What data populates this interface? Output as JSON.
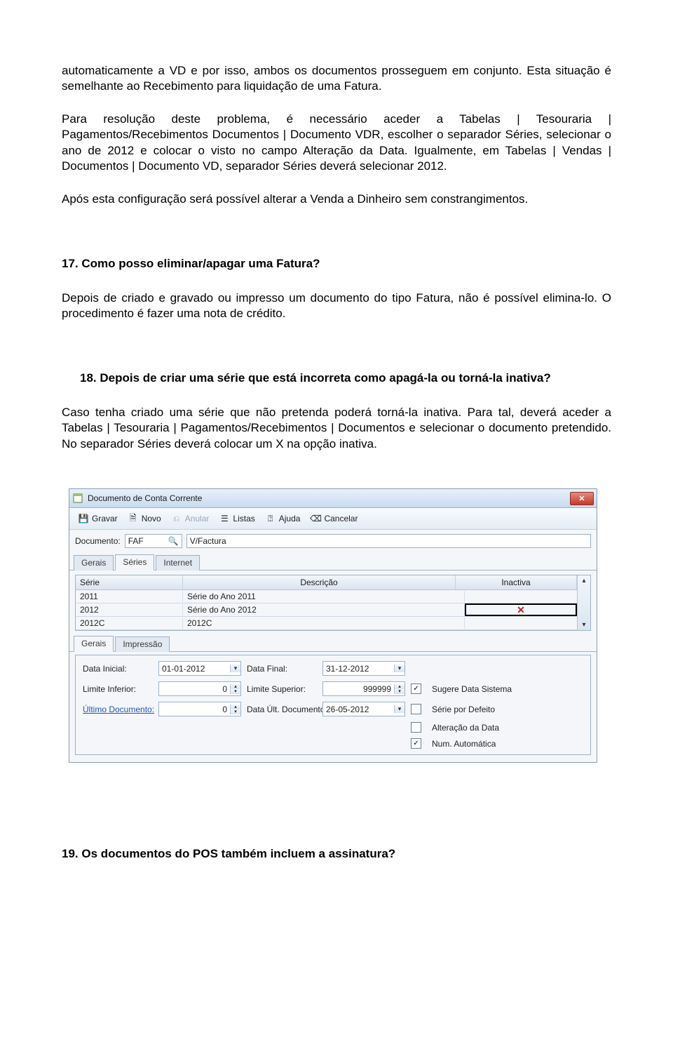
{
  "para1": "automaticamente a VD e por isso, ambos os documentos prosseguem em conjunto. Esta situação é semelhante ao Recebimento para liquidação de uma Fatura.",
  "para2": "Para resolução deste problema, é necessário aceder a Tabelas | Tesouraria | Pagamentos/Recebimentos Documentos | Documento VDR, escolher o separador Séries, selecionar o ano de 2012 e colocar o visto no campo Alteração da Data. Igualmente, em Tabelas | Vendas | Documentos | Documento VD, separador Séries deverá selecionar 2012.",
  "para3": "Após esta configuração será possível alterar a Venda a Dinheiro sem constrangimentos.",
  "q17_num": "17.",
  "q17_text": "Como posso eliminar/apagar uma Fatura?",
  "a17": "Depois de criado e gravado ou impresso um documento do tipo Fatura, não é possível elimina-lo. O procedimento é fazer uma nota de crédito.",
  "q18_num": "18.",
  "q18_text": "Depois de criar uma série que está incorreta como apagá-la ou torná-la inativa?",
  "a18": "Caso tenha criado uma série que não pretenda poderá torná-la inativa. Para tal, deverá aceder a Tabelas | Tesouraria | Pagamentos/Recebimentos | Documentos e selecionar o documento pretendido. No separador Séries deverá colocar um X na opção inativa.",
  "q19_num": "19.",
  "q19_text": "Os documentos do POS também incluem a assinatura?",
  "win": {
    "title": "Documento de Conta Corrente",
    "toolbar": {
      "gravar": "Gravar",
      "novo": "Novo",
      "anular": "Anular",
      "listas": "Listas",
      "ajuda": "Ajuda",
      "cancelar": "Cancelar"
    },
    "doc_label": "Documento:",
    "doc_code": "FAF",
    "doc_desc": "V/Factura",
    "tabs1": {
      "gerais": "Gerais",
      "series": "Séries",
      "internet": "Internet"
    },
    "grid": {
      "head_serie": "Série",
      "head_desc": "Descrição",
      "head_inact": "Inactiva",
      "rows": [
        {
          "serie": "2011",
          "desc": "Série do Ano 2011",
          "x": false,
          "boxed": false
        },
        {
          "serie": "2012",
          "desc": "Série do Ano 2012",
          "x": true,
          "boxed": true
        },
        {
          "serie": "2012C",
          "desc": "2012C",
          "x": false,
          "boxed": false
        }
      ]
    },
    "tabs2": {
      "gerais": "Gerais",
      "impressao": "Impressão"
    },
    "fields": {
      "data_inicial_label": "Data Inicial:",
      "data_inicial": "01-01-2012",
      "data_final_label": "Data Final:",
      "data_final": "31-12-2012",
      "limite_inf_label": "Limite Inferior:",
      "limite_inf": "0",
      "limite_sup_label": "Limite Superior:",
      "limite_sup": "999999",
      "ultimo_doc_label": "Último Documento:",
      "ultimo_doc": "0",
      "data_ult_label": "Data Últ. Documento:",
      "data_ult": "26-05-2012",
      "chk_sugere": "Sugere Data Sistema",
      "chk_defeito": "Série por Defeito",
      "chk_alteracao": "Alteração da Data",
      "chk_num": "Num. Automática"
    }
  }
}
